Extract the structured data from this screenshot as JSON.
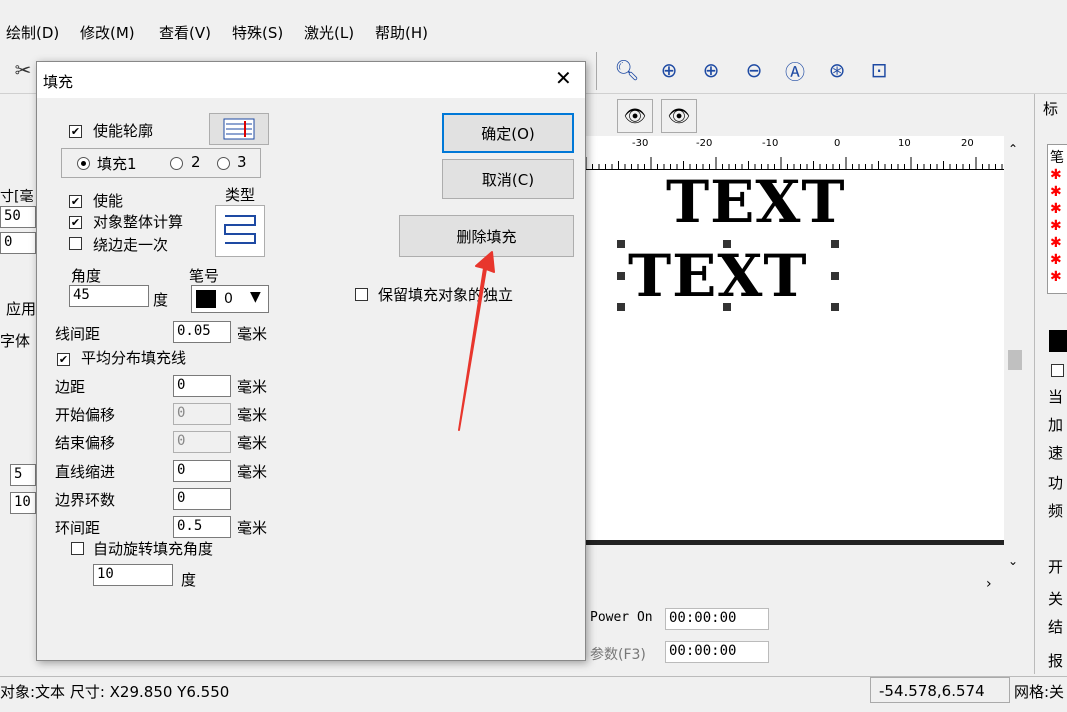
{
  "menu": [
    "绘制(D)",
    "修改(M)",
    "查看(V)",
    "特殊(S)",
    "激光(L)",
    "帮助(H)"
  ],
  "toolbar_icons": [
    "scissors-icon",
    "zoom-icon",
    "zoom-pan-icon",
    "zoom-in-icon",
    "zoom-out-icon",
    "zoom-all-icon",
    "zoom-selection-icon",
    "zoom-object-icon"
  ],
  "left_panel": {
    "size_label": "寸[毫",
    "value1": "50",
    "value2": "0",
    "apply": "应用",
    "font": "字体",
    "value3": "5",
    "value4": "10"
  },
  "canvas": {
    "ruler_ticks": [
      "-30",
      "-20",
      "-10",
      "0",
      "10",
      "20"
    ],
    "text1": "TEXT",
    "text2": "TEXT"
  },
  "right_panel": {
    "title": "标",
    "items": [
      "笔",
      "当",
      "加",
      "速",
      "功",
      "频",
      "开",
      "关",
      "结",
      "报"
    ]
  },
  "bottom": {
    "power_label": "Power On",
    "power_time": "00:00:00",
    "params_label": "参数(F3)",
    "params_time": "00:00:00"
  },
  "status": {
    "object": "对象:文本 尺寸: X29.850 Y6.550",
    "coords": "-54.578,6.574",
    "grid": "网格:关"
  },
  "dialog": {
    "title": "填充",
    "enable_outline": "使能轮廓",
    "fill1": "填充1",
    "fill2": "2",
    "fill3": "3",
    "enable": "使能",
    "whole_object": "对象整体计算",
    "around_once": "绕边走一次",
    "type_label": "类型",
    "angle_label": "角度",
    "angle_value": "45",
    "angle_unit": "度",
    "pen_label": "笔号",
    "pen_value": "0",
    "line_spacing_label": "线间距",
    "line_spacing_value": "0.05",
    "mm": "毫米",
    "avg_distribute": "平均分布填充线",
    "margin_label": "边距",
    "margin_value": "0",
    "start_offset_label": "开始偏移",
    "start_offset_value": "0",
    "end_offset_label": "结束偏移",
    "end_offset_value": "0",
    "line_indent_label": "直线缩进",
    "line_indent_value": "0",
    "border_loops_label": "边界环数",
    "border_loops_value": "0",
    "loop_spacing_label": "环间距",
    "loop_spacing_value": "0.5",
    "auto_rotate": "自动旋转填充角度",
    "rotate_value": "10",
    "rotate_unit": "度",
    "ok": "确定(O)",
    "cancel": "取消(C)",
    "delete_fill": "删除填充",
    "keep_independent": "保留填充对象的独立"
  }
}
